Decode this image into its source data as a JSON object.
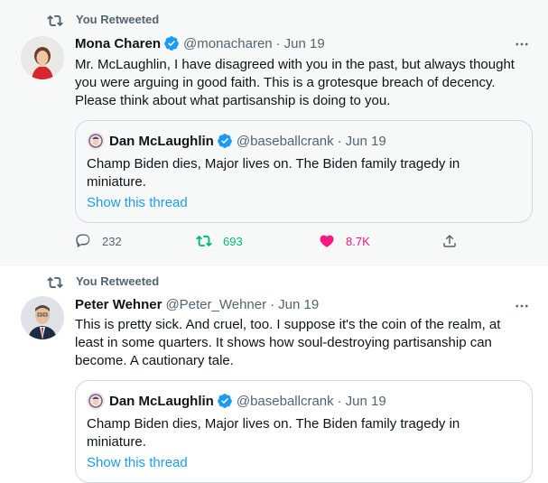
{
  "tweets": [
    {
      "retweet_label": "You Retweeted",
      "author_name": "Mona Charen",
      "handle": "@monacharen",
      "separator": "·",
      "date": "Jun 19",
      "text": "Mr. McLaughlin, I have disagreed with you in the past, but always thought you were arguing in good faith. This is a grotesque breach of decency. Please think about what partisanship is doing to you.",
      "quote": {
        "author_name": "Dan McLaughlin",
        "handle": "@baseballcrank",
        "separator": "·",
        "date": "Jun 19",
        "text": "Champ Biden dies, Major lives on. The Biden family tragedy in miniature.",
        "link": "Show this thread"
      },
      "replies": "232",
      "retweets": "693",
      "likes": "8.7K"
    },
    {
      "retweet_label": "You Retweeted",
      "author_name": "Peter Wehner",
      "handle": "@Peter_Wehner",
      "separator": "·",
      "date": "Jun 19",
      "text": "This is pretty sick. And cruel, too. I suppose it's the coin of the realm, at least in some quarters. It shows how soul-destroying partisanship can become. A cautionary tale.",
      "quote": {
        "author_name": "Dan McLaughlin",
        "handle": "@baseballcrank",
        "separator": "·",
        "date": "Jun 19",
        "text": "Champ Biden dies, Major lives on. The Biden family tragedy in miniature.",
        "link": "Show this thread"
      }
    }
  ],
  "colors": {
    "accent": "#1d9bf0",
    "retweet_green": "#00ba7c",
    "like_pink": "#f91880",
    "muted": "#536471"
  }
}
